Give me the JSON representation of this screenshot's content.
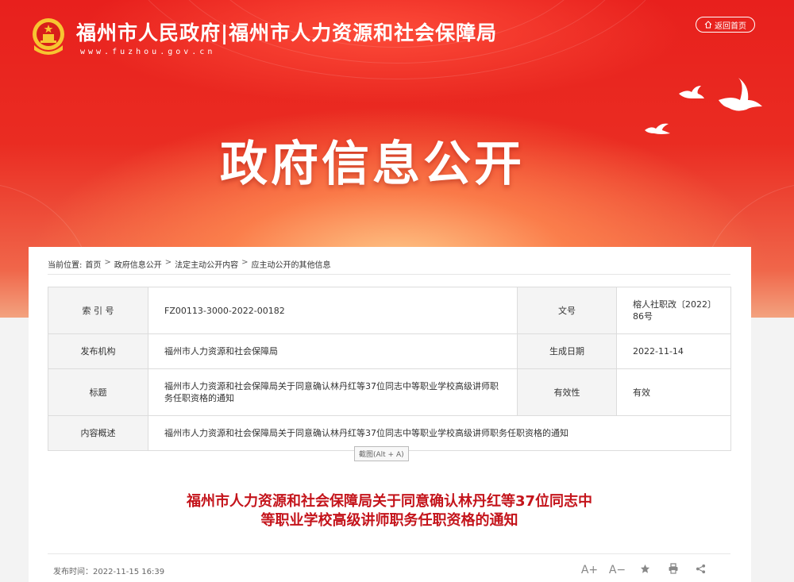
{
  "header": {
    "site_title": "福州市人民政府|福州市人力资源和社会保障局",
    "site_url": "www.fuzhou.gov.cn",
    "home_button": "返回首页",
    "hero_title": "政府信息公开"
  },
  "breadcrumb": {
    "prefix": "当前位置:",
    "items": [
      "首页",
      "政府信息公开",
      "法定主动公开内容",
      "应主动公开的其他信息"
    ],
    "separator": ">"
  },
  "meta_table": {
    "index_label": "索 引 号",
    "index_value": "FZ00113-3000-2022-00182",
    "doc_no_label": "文号",
    "doc_no_value": "榕人社职改〔2022〕86号",
    "issuer_label": "发布机构",
    "issuer_value": "福州市人力资源和社会保障局",
    "date_label": "生成日期",
    "date_value": "2022-11-14",
    "title_label": "标题",
    "title_value": "福州市人力资源和社会保障局关于同意确认林丹红等37位同志中等职业学校高级讲师职务任职资格的通知",
    "validity_label": "有效性",
    "validity_value": "有效",
    "summary_label": "内容概述",
    "summary_value": "福州市人力资源和社会保障局关于同意确认林丹红等37位同志中等职业学校高级讲师职务任职资格的通知"
  },
  "tooltip": "截图(Alt + A)",
  "document": {
    "title_line1": "福州市人力资源和社会保障局关于同意确认林丹红等37位同志中",
    "title_line2": "等职业学校高级讲师职务任职资格的通知",
    "publish_time": "发布时间：2022-11-15 16:39"
  },
  "tools": {
    "font_larger": "A+",
    "font_smaller": "A−",
    "icons": [
      "star-icon",
      "print-icon",
      "share-icon"
    ]
  },
  "colors": {
    "banner_red": "#e8201d",
    "title_red": "#c4141b"
  }
}
